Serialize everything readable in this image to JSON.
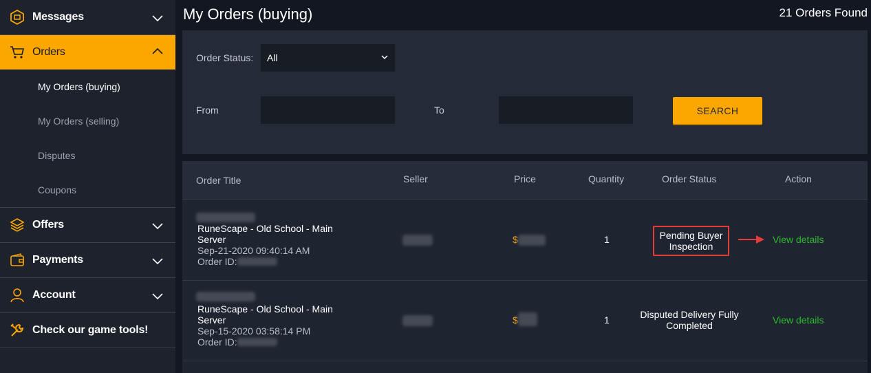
{
  "sidebar": {
    "items": [
      {
        "label": "Messages",
        "icon": "messages-icon"
      },
      {
        "label": "Orders",
        "icon": "cart-icon"
      },
      {
        "label": "Offers",
        "icon": "layers-icon"
      },
      {
        "label": "Payments",
        "icon": "wallet-icon"
      },
      {
        "label": "Account",
        "icon": "user-icon"
      },
      {
        "label": "Check our game tools!",
        "icon": "wrench-icon"
      }
    ],
    "orders_sub": [
      "My Orders (buying)",
      "My Orders (selling)",
      "Disputes",
      "Coupons"
    ]
  },
  "header": {
    "title": "My Orders (buying)",
    "count": "21 Orders Found"
  },
  "filters": {
    "status_label": "Order Status:",
    "status_value": "All",
    "from_label": "From",
    "to_label": "To",
    "search_label": "SEARCH"
  },
  "table": {
    "columns": [
      "Order Title",
      "Seller",
      "Price",
      "Quantity",
      "Order Status",
      "Action"
    ],
    "rows": [
      {
        "title": "RuneScape - Old School - Main Server",
        "date": "Sep-21-2020 09:40:14 AM",
        "order_id_label": "Order ID:",
        "price_symbol": "$",
        "quantity": "1",
        "status": "Pending Buyer Inspection",
        "action": "View details"
      },
      {
        "title": "RuneScape - Old School - Main Server",
        "date": "Sep-15-2020 03:58:14 PM",
        "order_id_label": "Order ID:",
        "price_symbol": "$",
        "quantity": "1",
        "status": "Disputed Delivery Fully Completed",
        "action": "View details"
      }
    ]
  },
  "colors": {
    "accent": "#fca600",
    "link": "#2dbb2d",
    "highlight": "#e53b3b"
  }
}
